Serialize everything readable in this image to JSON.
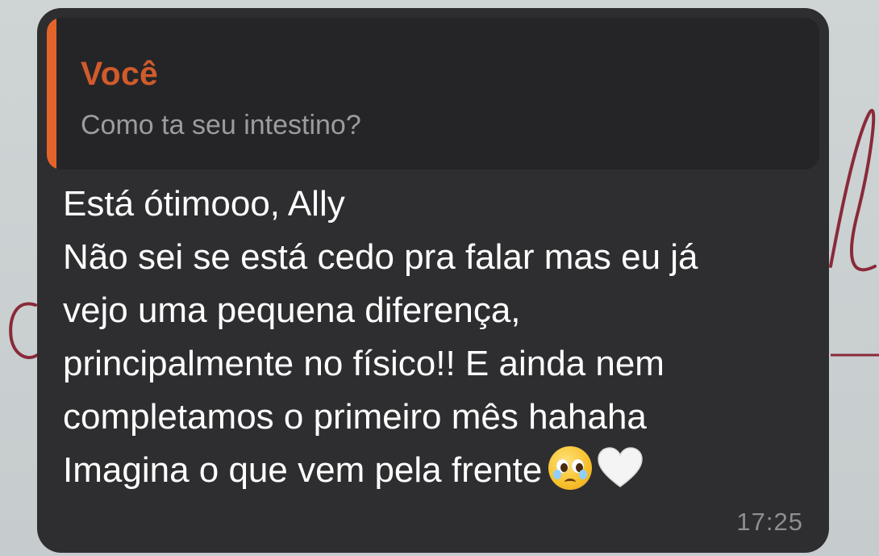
{
  "message": {
    "reply": {
      "author": "Você",
      "text": "Como ta seu intestino?"
    },
    "lines": [
      "Está ótimooo, Ally",
      "Não sei se está cedo pra falar mas eu já",
      "vejo uma pequena diferença,",
      "principalmente no físico!! E ainda nem",
      "completamos o primeiro mês hahaha",
      "Imagina o que vem pela frente"
    ],
    "emojis": [
      "pleading-face-icon",
      "white-heart-icon"
    ],
    "time": "17:25"
  },
  "colors": {
    "bubble": "#2e2e30",
    "quote_background": "#252527",
    "quote_accent": "#e3642a",
    "quote_author": "#d25b2c",
    "message_text": "#ffffff",
    "wallpaper": "#c9cfcf",
    "wallpaper_script": "#8a2a3a"
  }
}
